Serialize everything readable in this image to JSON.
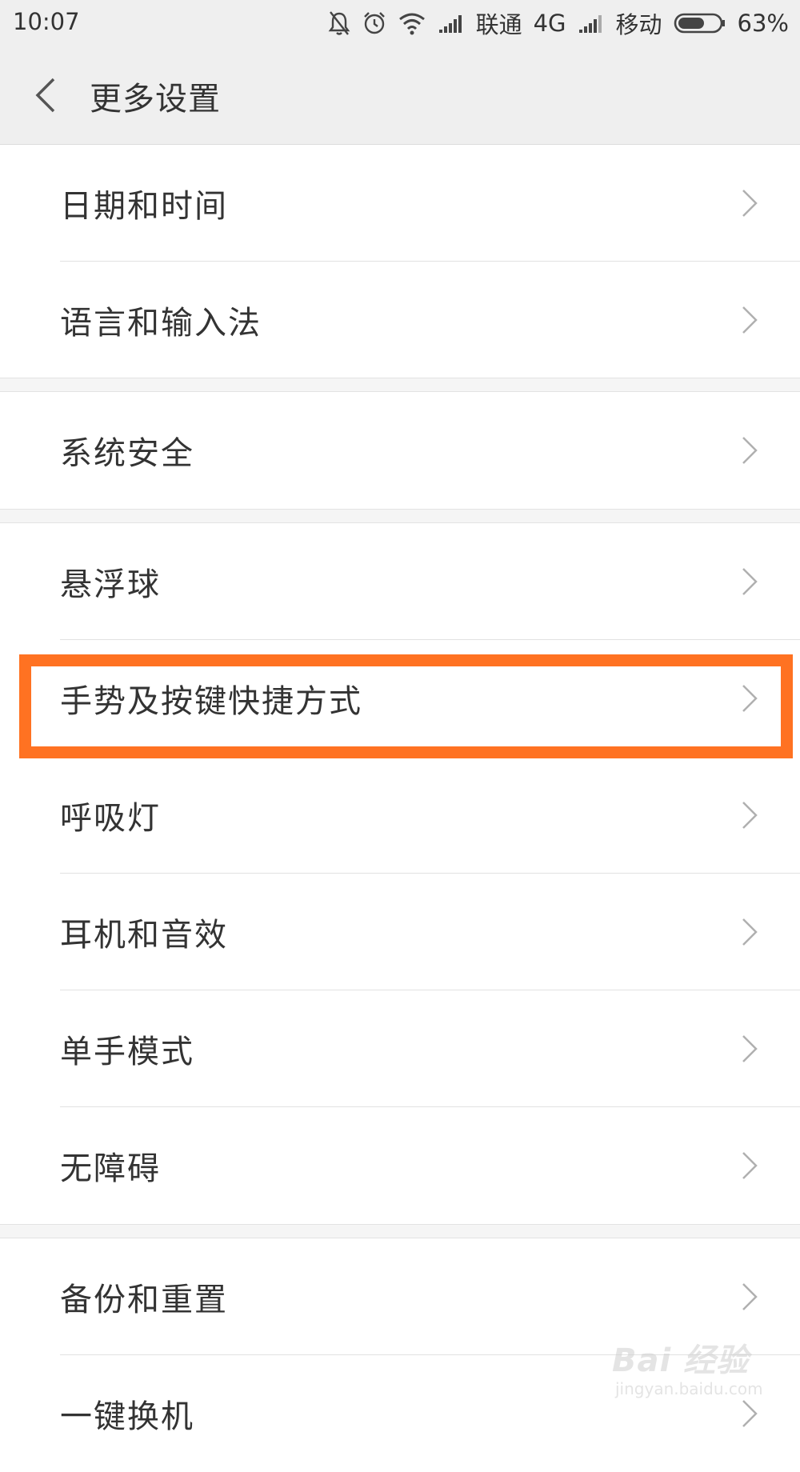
{
  "status_bar": {
    "time": "10:07",
    "carrier1": "联通",
    "network": "4G",
    "carrier2": "移动",
    "battery": "63%",
    "battery_level": 0.63
  },
  "header": {
    "title": "更多设置"
  },
  "items": [
    {
      "label": "日期和时间"
    },
    {
      "label": "语言和输入法"
    },
    {
      "label": "系统安全"
    },
    {
      "label": "悬浮球"
    },
    {
      "label": "手势及按键快捷方式"
    },
    {
      "label": "呼吸灯"
    },
    {
      "label": "耳机和音效"
    },
    {
      "label": "单手模式"
    },
    {
      "label": "无障碍"
    },
    {
      "label": "备份和重置"
    },
    {
      "label": "一键换机"
    }
  ],
  "highlight_color": "#ff7222",
  "watermark": {
    "main": "Bai 经验",
    "sub": "jingyan.baidu.com"
  },
  "icons": [
    "bell-off-icon",
    "alarm-icon",
    "wifi-icon",
    "signal-icon",
    "battery-icon",
    "back-icon",
    "chevron-right-icon"
  ]
}
